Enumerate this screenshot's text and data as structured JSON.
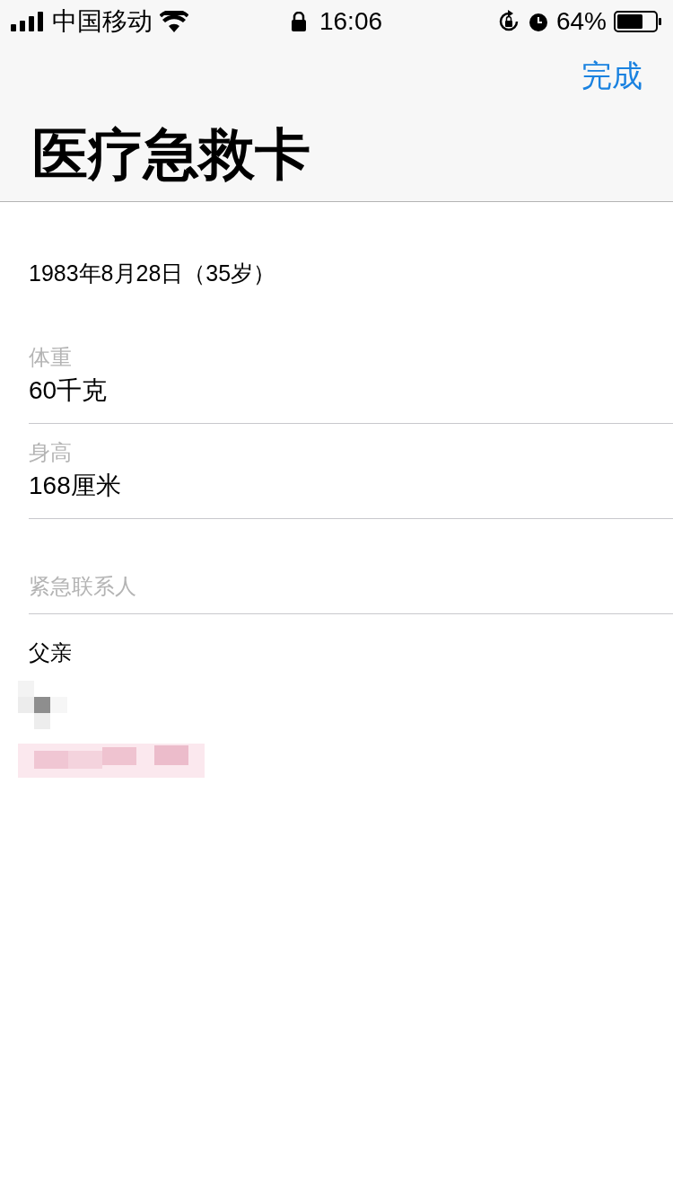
{
  "status_bar": {
    "carrier": "中国移动",
    "time": "16:06",
    "battery": "64%"
  },
  "nav": {
    "done": "完成",
    "title": "医疗急救卡"
  },
  "birthday": "1983年8月28日（35岁）",
  "fields": [
    {
      "label": "体重",
      "value": "60千克"
    },
    {
      "label": "身高",
      "value": "168厘米"
    }
  ],
  "emergency_contacts": {
    "header": "紧急联系人",
    "contacts": [
      {
        "relation": "父亲"
      }
    ]
  }
}
